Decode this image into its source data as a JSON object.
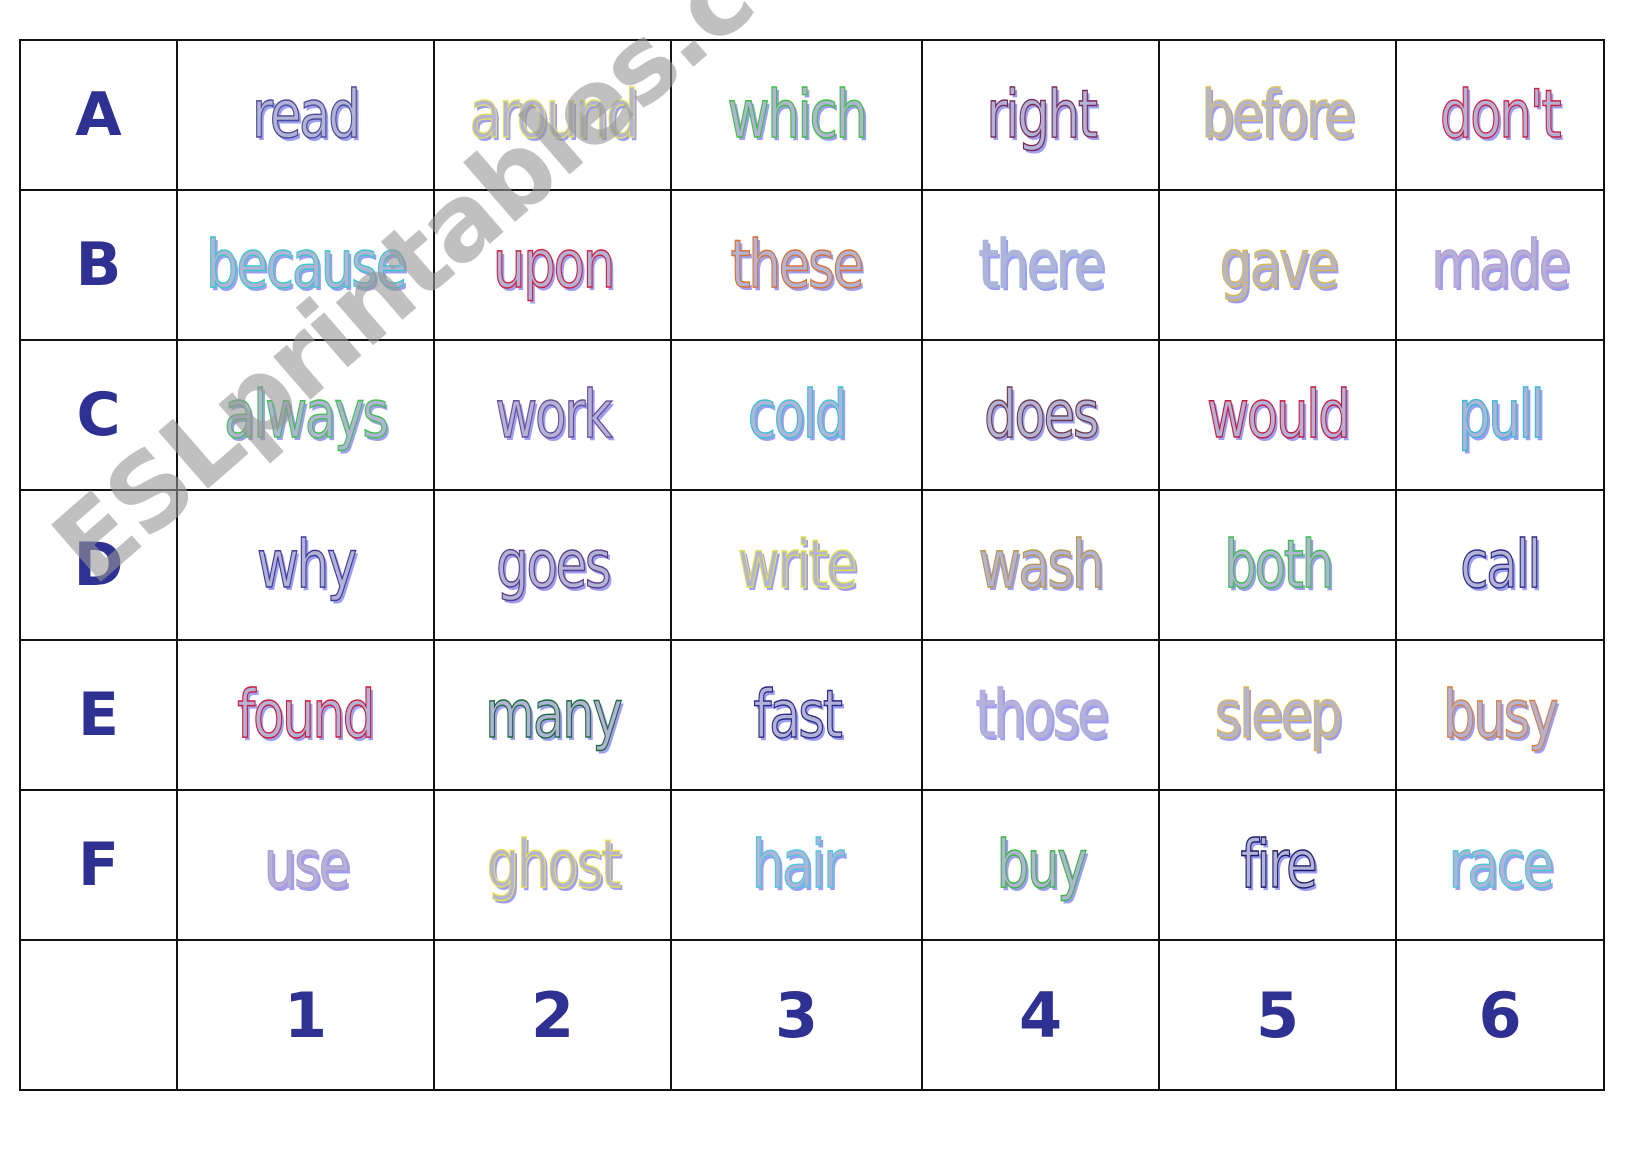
{
  "rows": [
    {
      "label": "A",
      "words": [
        {
          "text": "read",
          "stroke": "#4a4a9a"
        },
        {
          "text": "around",
          "stroke": "#e2e060"
        },
        {
          "text": "which",
          "stroke": "#3cc040"
        },
        {
          "text": "right",
          "stroke": "#7a2a5a"
        },
        {
          "text": "before",
          "stroke": "#d8c060"
        },
        {
          "text": "don't",
          "stroke": "#d02040"
        }
      ]
    },
    {
      "label": "B",
      "words": [
        {
          "text": "because",
          "stroke": "#38c8c8"
        },
        {
          "text": "upon",
          "stroke": "#d02040"
        },
        {
          "text": "these",
          "stroke": "#d87030"
        },
        {
          "text": "there",
          "stroke": "#a0b8e0"
        },
        {
          "text": "gave",
          "stroke": "#d8b848"
        },
        {
          "text": "made",
          "stroke": "#b898d8"
        }
      ]
    },
    {
      "label": "C",
      "words": [
        {
          "text": "always",
          "stroke": "#40c050"
        },
        {
          "text": "work",
          "stroke": "#6a4a9a"
        },
        {
          "text": "cold",
          "stroke": "#38c0d8"
        },
        {
          "text": "does",
          "stroke": "#6a3a4a"
        },
        {
          "text": "would",
          "stroke": "#c81840"
        },
        {
          "text": "pull",
          "stroke": "#38b8d8"
        }
      ]
    },
    {
      "label": "D",
      "words": [
        {
          "text": "why",
          "stroke": "#3a3a9a"
        },
        {
          "text": "goes",
          "stroke": "#5a3a8a"
        },
        {
          "text": "write",
          "stroke": "#e0e050"
        },
        {
          "text": "wash",
          "stroke": "#b89848"
        },
        {
          "text": "both",
          "stroke": "#38c048"
        },
        {
          "text": "call",
          "stroke": "#2a2a8a"
        }
      ]
    },
    {
      "label": "E",
      "words": [
        {
          "text": "found",
          "stroke": "#d01838"
        },
        {
          "text": "many",
          "stroke": "#1a6a3a"
        },
        {
          "text": "fast",
          "stroke": "#2a2a8a"
        },
        {
          "text": "those",
          "stroke": "#b0a8e8"
        },
        {
          "text": "sleep",
          "stroke": "#d8b850"
        },
        {
          "text": "busy",
          "stroke": "#d88040"
        }
      ]
    },
    {
      "label": "F",
      "words": [
        {
          "text": "use",
          "stroke": "#b098d8"
        },
        {
          "text": "ghost",
          "stroke": "#e8e050"
        },
        {
          "text": "hair",
          "stroke": "#48c8e0"
        },
        {
          "text": "buy",
          "stroke": "#38b840"
        },
        {
          "text": "fire",
          "stroke": "#1a1a6a"
        },
        {
          "text": "race",
          "stroke": "#48c8d8"
        }
      ]
    }
  ],
  "footer": {
    "corner": "",
    "numbers": [
      "1",
      "2",
      "3",
      "4",
      "5",
      "6"
    ]
  },
  "label_color": "#2e3192",
  "watermark": "ESLprintables.com"
}
